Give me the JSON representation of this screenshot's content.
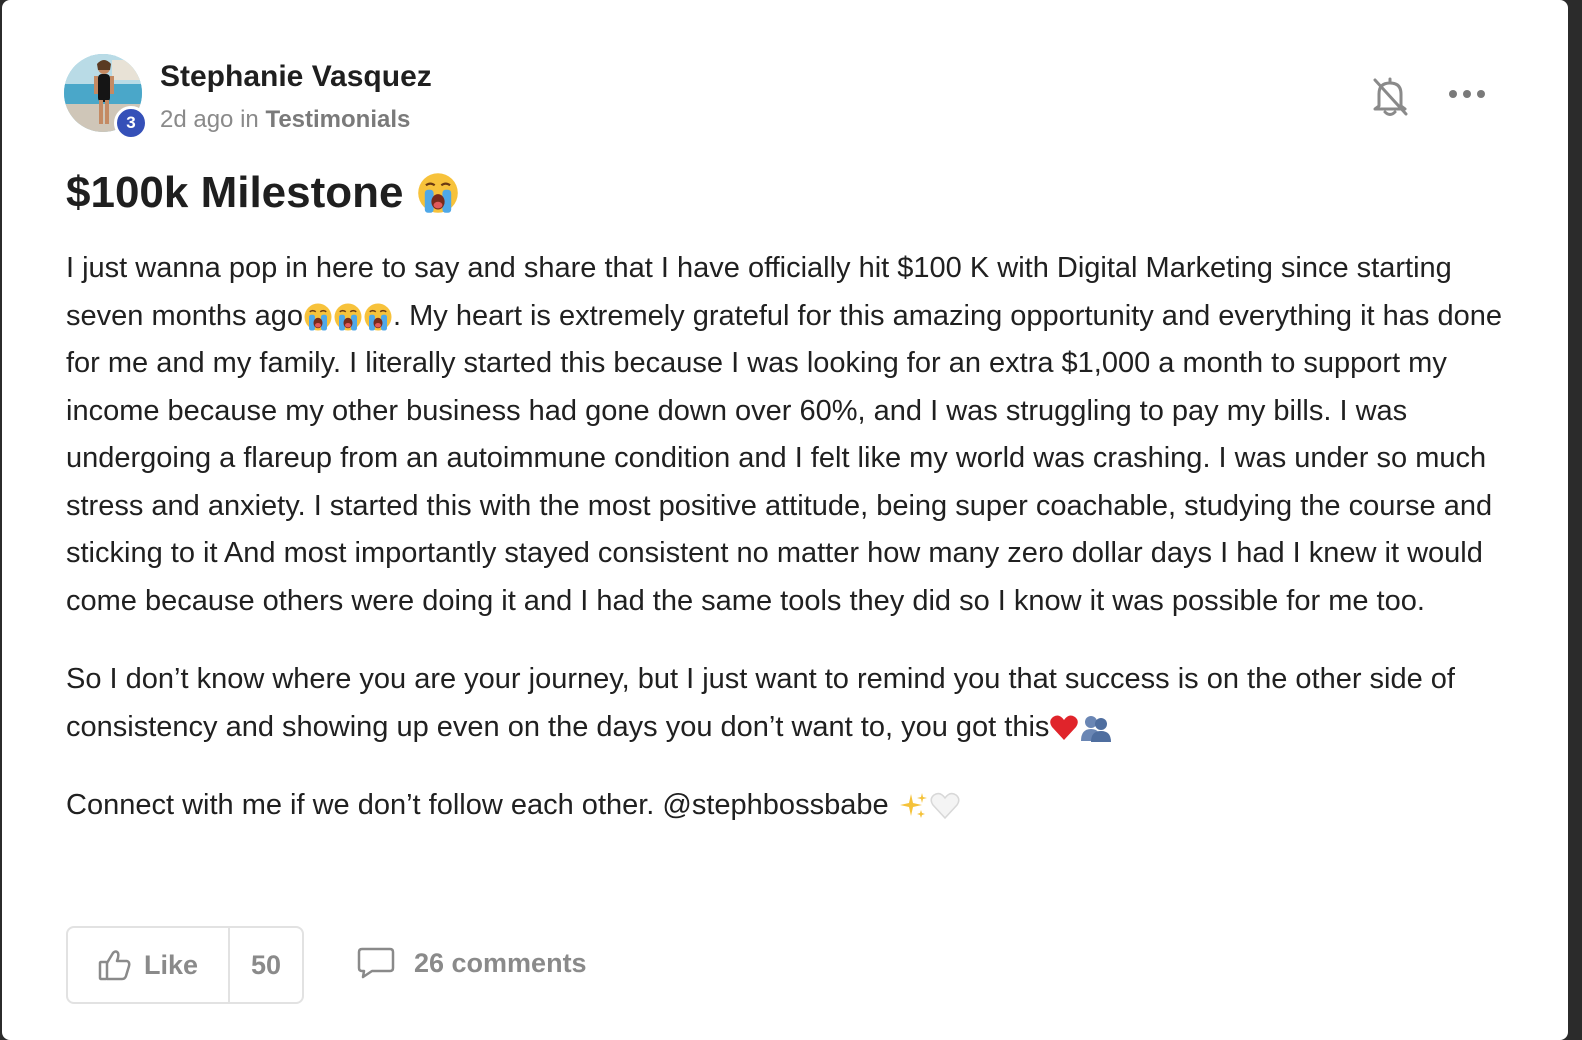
{
  "post": {
    "author": {
      "name": "Stephanie Vasquez",
      "level": "3"
    },
    "meta": {
      "time": "2d ago",
      "in_word": "in",
      "category": "Testimonials"
    },
    "title": "$100k Milestone",
    "paragraphs": [
      {
        "before": "I just wanna pop in here to say and share that I have officially hit $100 K with Digital Marketing since starting seven months ago",
        "after": ". My heart is extremely grateful for this amazing opportunity and everything it has done for me and my family. I literally started this because I was looking for an extra $1,000 a month to support my income because my other business had gone down over 60%, and I was struggling to pay my bills. I was undergoing a flareup from an autoimmune condition and I felt like my world was crashing. I was under so much stress and anxiety. I started this with the most positive attitude, being super coachable, studying the course and sticking to it And most importantly stayed consistent no matter how many zero dollar days I had I knew it would come because others were doing it and I had the same tools they did so I know it was possible for me too."
      },
      {
        "before": "So I don’t know where you are your journey, but I just want to remind you that success is on the other side of consistency and showing up even on the days you don’t want to, you got this"
      },
      {
        "before": "Connect with me if we don’t follow each other. @stephbossbabe "
      }
    ],
    "emojis": {
      "title": "crying-face",
      "para1": [
        "crying-face",
        "crying-face",
        "crying-face"
      ],
      "para2": [
        "red-heart",
        "busts-in-silhouette"
      ],
      "para3": [
        "sparkles",
        "white-heart"
      ]
    }
  },
  "actions": {
    "like_label": "Like",
    "like_count": "50",
    "comments_label": "26 comments"
  },
  "colors": {
    "badge": "#3550b8",
    "text": "#202020",
    "muted": "#8a8a8a",
    "border": "#e2e2e2"
  }
}
